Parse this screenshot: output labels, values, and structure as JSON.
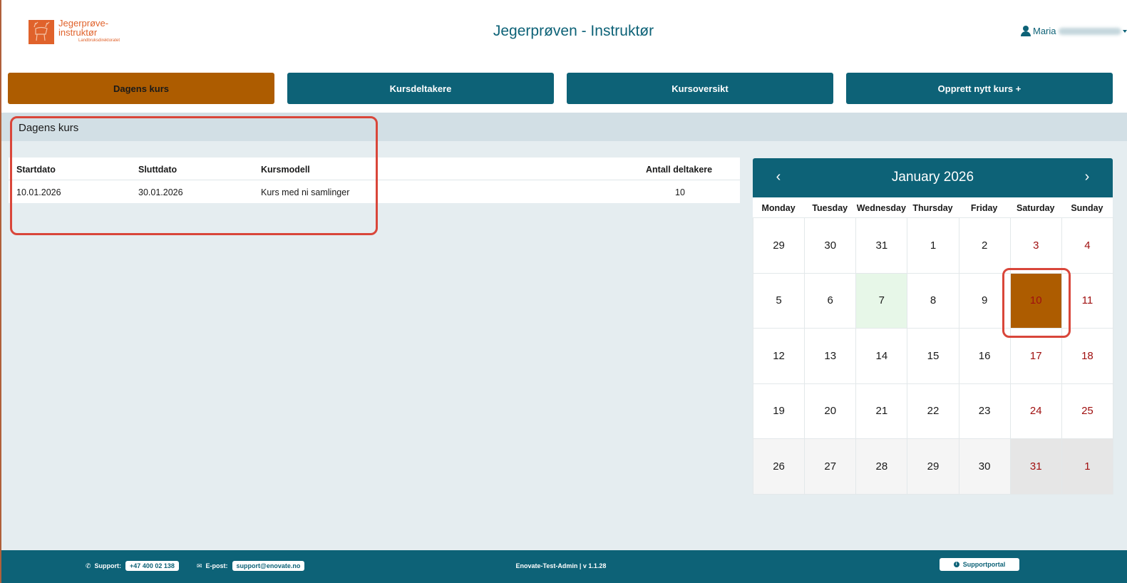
{
  "header": {
    "logo_line1": "Jegerprøve-",
    "logo_line2": "instruktør",
    "logo_line3": "Landbruksdirektoratet",
    "title": "Jegerprøven - Instruktør",
    "user_name": "Maria"
  },
  "nav": {
    "items": [
      {
        "label": "Dagens kurs"
      },
      {
        "label": "Kursdeltakere"
      },
      {
        "label": "Kursoversikt"
      },
      {
        "label": "Opprett nytt kurs +"
      }
    ]
  },
  "section": {
    "title": "Dagens kurs"
  },
  "table": {
    "headers": [
      "Startdato",
      "Sluttdato",
      "Kursmodell",
      "Antall deltakere"
    ],
    "rows": [
      [
        "10.01.2026",
        "30.01.2026",
        "Kurs med ni samlinger",
        "10"
      ]
    ]
  },
  "calendar": {
    "month_label": "January 2026",
    "prev": "‹",
    "next": "›",
    "weekdays": [
      "Monday",
      "Tuesday",
      "Wednesday",
      "Thursday",
      "Friday",
      "Saturday",
      "Sunday"
    ],
    "days": [
      "29",
      "30",
      "31",
      "1",
      "2",
      "3",
      "4",
      "5",
      "6",
      "7",
      "8",
      "9",
      "10",
      "11",
      "12",
      "13",
      "14",
      "15",
      "16",
      "17",
      "18",
      "19",
      "20",
      "21",
      "22",
      "23",
      "24",
      "25",
      "26",
      "27",
      "28",
      "29",
      "30",
      "31",
      "1"
    ],
    "selected_day": "10",
    "colors": {
      "selected": "#ad5c00",
      "weekend_text": "#a01010",
      "today_tint": "#e7f7e8"
    }
  },
  "footer": {
    "support_label": "Support:",
    "support_phone": "+47 400 02 138",
    "email_label": "E-post:",
    "email": "support@enovate.no",
    "version": "Enovate-Test-Admin | v 1.1.28",
    "portal": "Supportportal"
  },
  "colors": {
    "primary": "#0d6277",
    "accent": "#ad5c00",
    "highlight": "#d9463a"
  }
}
